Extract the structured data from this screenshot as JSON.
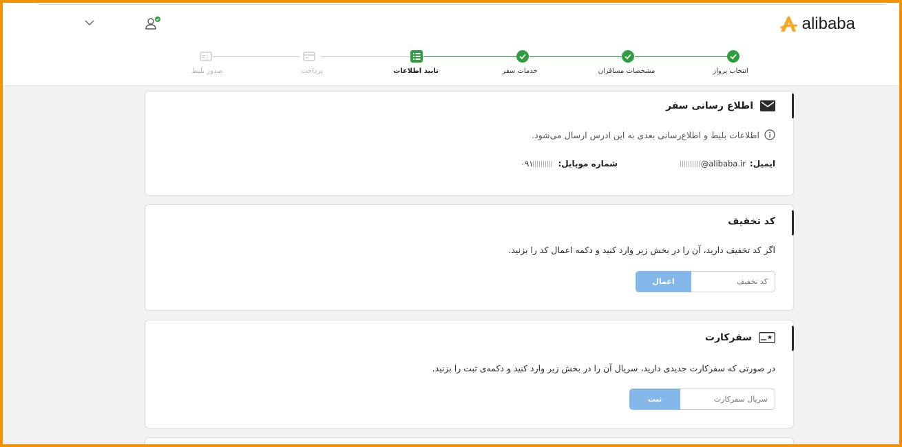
{
  "brand": {
    "name": "alibaba",
    "accent": "#f9a825"
  },
  "header": {
    "user_icon": "user-verified-icon",
    "dropdown_icon": "chevron-down-icon"
  },
  "stepper": {
    "active_color": "#2e9e3f",
    "inactive_color": "#c4c4c4",
    "steps": [
      {
        "label": "انتخاب پرواز",
        "status": "done"
      },
      {
        "label": "مشخصات مسافران",
        "status": "done"
      },
      {
        "label": "خدمات سفر",
        "status": "done"
      },
      {
        "label": "تایید اطلاعات",
        "status": "current"
      },
      {
        "label": "پرداخت",
        "status": "pending"
      },
      {
        "label": "صدور بلیط",
        "status": "pending"
      }
    ]
  },
  "notification": {
    "title": "اطلاع رسانی سفر",
    "info": "اطلاعات بلیط و اطلاع‌رسانی بعدی به این ادرس ارسال می‌شود.",
    "email_label": "ایمیل:",
    "email_suffix": "@alibaba.ir",
    "mobile_label": "شماره موبایل:",
    "mobile_prefix": "۰۹۱"
  },
  "discount": {
    "title": "کد تخفیف",
    "description": "اگر کد تخفیف دارید، آن را در بخش زیر وارد کنید و دکمه اعمال کد را بزنید.",
    "placeholder": "کد تخفیف",
    "button": "اعمال"
  },
  "safarcard": {
    "title": "سفرکارت",
    "description": "در صورتی که سفرکارت جدیدی دارید، سریال آن را در بخش زیر وارد کنید و دکمه‌ی ثبت را بزنید.",
    "placeholder": "سریال سفرکارت",
    "button": "ثبت"
  }
}
